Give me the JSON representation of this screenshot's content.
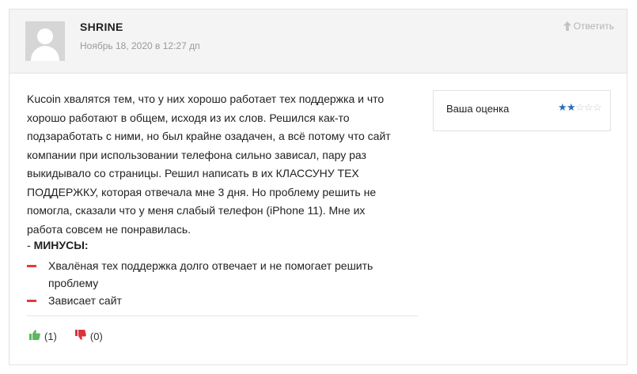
{
  "comment": {
    "author": "SHRINE",
    "date": "Ноябрь 18, 2020 в 12:27 дп",
    "reply_label": "Ответить",
    "text": "Kucoin хвалятся тем, что у них хорошо работает тех поддержка и что хорошо работают в общем, исходя из их слов. Решился как-то подзаработать с ними, но был крайне озадачен, а всё потому что сайт компании при использовании телефона сильно зависал, пару раз выкидывало со страницы. Решил написать в их КЛАССУНУ ТЕХ ПОДДЕРЖКУ, которая отвечала мне 3 дня. Но проблему решить не помогла, сказали что у меня слабый телефон (iPhone 11). Мне их работа совсем не понравилась.",
    "minus_prefix": "- ",
    "minus_title": "МИНУСЫ:",
    "cons": [
      "Хвалёная тех поддержка долго отвечает и не помогает решить проблему",
      "Зависает сайт"
    ],
    "likes": "(1)",
    "dislikes": "(0)",
    "rating_label": "Ваша оценка",
    "rating_value": 2,
    "rating_max": 5
  },
  "colors": {
    "header_bg": "#f4f4f4",
    "star_filled": "#2f6db5",
    "star_empty": "#c8c8c8",
    "thumb_up": "#5cb85c",
    "thumb_down": "#d9343c",
    "minus_dash": "#e23b3b"
  },
  "icons": {
    "reply": "arrow-up-icon",
    "like": "thumbs-up-icon",
    "dislike": "thumbs-down-icon",
    "avatar": "default-user-avatar"
  }
}
